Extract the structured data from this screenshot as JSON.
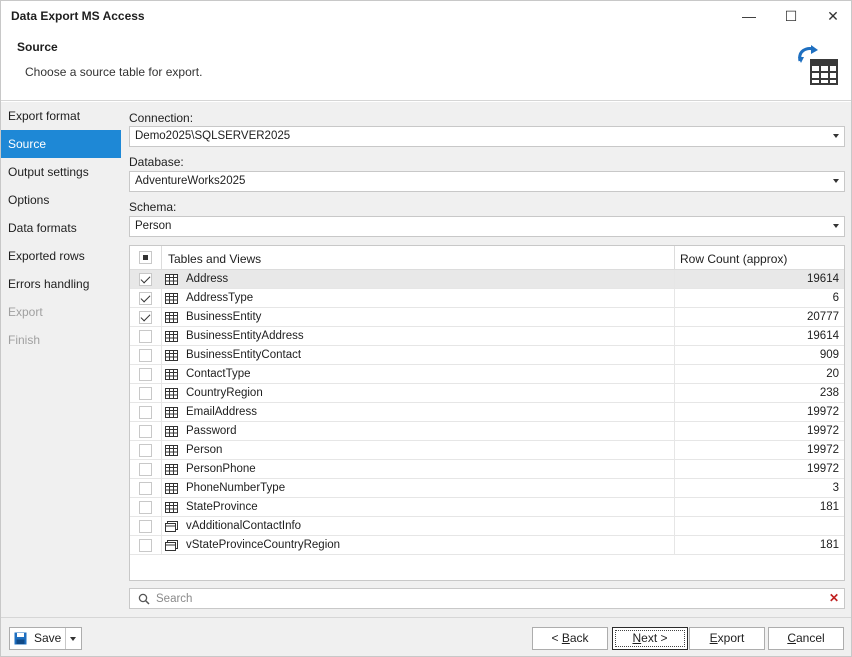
{
  "window": {
    "title": "Data Export MS Access",
    "minimize_glyph": "—",
    "maximize_glyph": "☐",
    "close_glyph": "✕"
  },
  "header": {
    "title": "Source",
    "subtitle": "Choose a source table for export.",
    "icon": "table-export-icon"
  },
  "sidebar": {
    "items": [
      {
        "label": "Export format",
        "state": "normal"
      },
      {
        "label": "Source",
        "state": "active"
      },
      {
        "label": "Output settings",
        "state": "normal"
      },
      {
        "label": "Options",
        "state": "normal"
      },
      {
        "label": "Data formats",
        "state": "normal"
      },
      {
        "label": "Exported rows",
        "state": "normal"
      },
      {
        "label": "Errors handling",
        "state": "normal"
      },
      {
        "label": "Export",
        "state": "disabled"
      },
      {
        "label": "Finish",
        "state": "disabled"
      }
    ]
  },
  "form": {
    "connection_label": "Connection:",
    "connection_value": "Demo2025\\SQLSERVER2025",
    "database_label": "Database:",
    "database_value": "AdventureWorks2025",
    "schema_label": "Schema:",
    "schema_value": "Person"
  },
  "grid": {
    "columns": {
      "name": "Tables and Views",
      "count": "Row Count (approx)"
    },
    "rows": [
      {
        "name": "Address",
        "count": "19614",
        "checked": true,
        "kind": "table"
      },
      {
        "name": "AddressType",
        "count": "6",
        "checked": true,
        "kind": "table"
      },
      {
        "name": "BusinessEntity",
        "count": "20777",
        "checked": true,
        "kind": "table"
      },
      {
        "name": "BusinessEntityAddress",
        "count": "19614",
        "checked": false,
        "kind": "table"
      },
      {
        "name": "BusinessEntityContact",
        "count": "909",
        "checked": false,
        "kind": "table"
      },
      {
        "name": "ContactType",
        "count": "20",
        "checked": false,
        "kind": "table"
      },
      {
        "name": "CountryRegion",
        "count": "238",
        "checked": false,
        "kind": "table"
      },
      {
        "name": "EmailAddress",
        "count": "19972",
        "checked": false,
        "kind": "table"
      },
      {
        "name": "Password",
        "count": "19972",
        "checked": false,
        "kind": "table"
      },
      {
        "name": "Person",
        "count": "19972",
        "checked": false,
        "kind": "table"
      },
      {
        "name": "PersonPhone",
        "count": "19972",
        "checked": false,
        "kind": "table"
      },
      {
        "name": "PhoneNumberType",
        "count": "3",
        "checked": false,
        "kind": "table"
      },
      {
        "name": "StateProvince",
        "count": "181",
        "checked": false,
        "kind": "table"
      },
      {
        "name": "vAdditionalContactInfo",
        "count": "",
        "checked": false,
        "kind": "view"
      },
      {
        "name": "vStateProvinceCountryRegion",
        "count": "181",
        "checked": false,
        "kind": "view"
      }
    ]
  },
  "search": {
    "placeholder": "Search",
    "clear_glyph": "✕"
  },
  "footer": {
    "save_label": "Save",
    "back_prefix": "< ",
    "back_key": "B",
    "back_rest": "ack",
    "next_key": "N",
    "next_rest": "ext >",
    "export_key": "E",
    "export_rest": "xport",
    "cancel_key": "C",
    "cancel_rest": "ancel"
  },
  "colors": {
    "accent": "#1e88d6",
    "icon_blue": "#1e6fc0",
    "clear_red": "#c02020"
  }
}
